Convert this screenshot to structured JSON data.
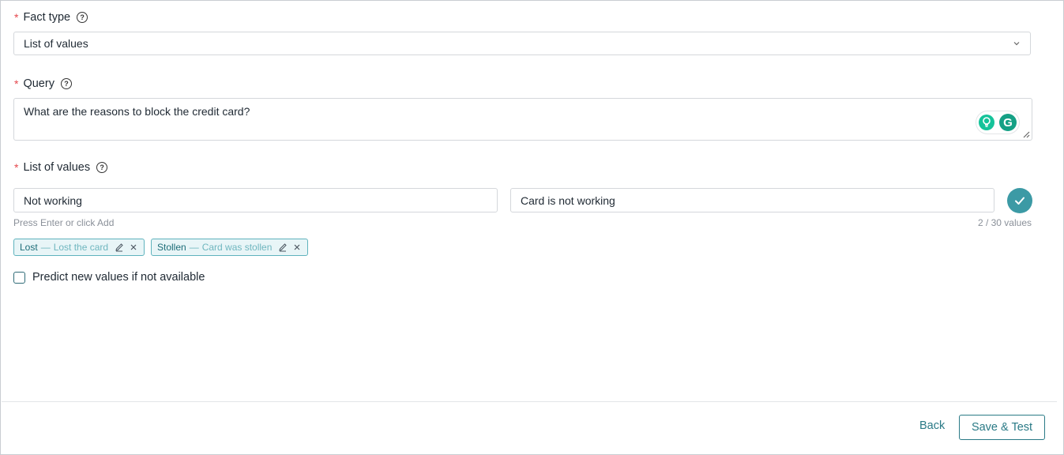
{
  "fact_type": {
    "label": "Fact type",
    "required_mark": "*",
    "help_icon": "question-circle-icon",
    "selected_value": "List of values"
  },
  "query": {
    "label": "Query",
    "required_mark": "*",
    "help_icon": "question-circle-icon",
    "value": "What are the reasons to block the credit card?"
  },
  "list_of_values": {
    "label": "List of values",
    "required_mark": "*",
    "help_icon": "question-circle-icon",
    "key_input_value": "Not working",
    "description_input_value": "Card is not working",
    "hint": "Press Enter or click Add",
    "count": "2 / 30 values",
    "add_icon": "check-circle-icon",
    "tags": [
      {
        "key": "Lost",
        "separator": "—",
        "value": "Lost the card"
      },
      {
        "key": "Stollen",
        "separator": "—",
        "value": "Card was stollen"
      }
    ]
  },
  "predict": {
    "label": "Predict new values if not available",
    "checked": false
  },
  "footer": {
    "back_label": "Back",
    "save_label": "Save & Test"
  },
  "colors": {
    "accent": "#3c9aa5",
    "required": "#e5484d",
    "tag_bg": "#e8f5f7",
    "tag_border": "#5fb3bd"
  }
}
